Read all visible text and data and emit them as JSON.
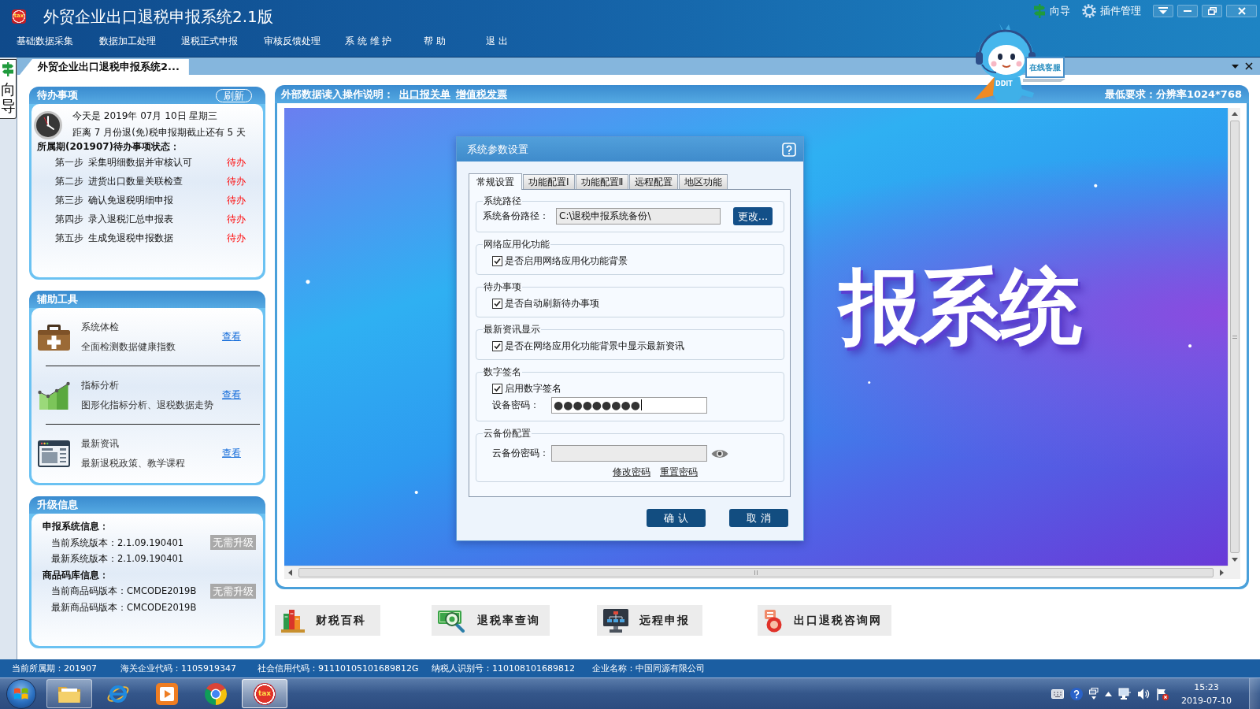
{
  "window": {
    "title": "外贸企业出口退税申报系统2.1版",
    "icon_text": "tax",
    "top_links": [
      {
        "kind": "guide",
        "label": "向导"
      },
      {
        "kind": "plugins",
        "label": "插件管理"
      }
    ]
  },
  "menu": [
    "基础数据采集",
    "数据加工处理",
    "退税正式申报",
    "审核反馈处理",
    "系 统 维 护",
    "帮 助",
    "退 出"
  ],
  "doc_tabs": [
    {
      "label": "外贸企业出口退税申报系统2...",
      "selected": true
    }
  ],
  "guide_tab": {
    "label": "向导"
  },
  "mascot": {
    "sign": "在线客服",
    "chest_text": "DDIT"
  },
  "todo_panel": {
    "title": "待办事项",
    "refresh": "刷新",
    "date_line": "今天是 2019年 07月 10日 星期三",
    "deadline_line": "距离 7 月份退(免)税申报期截止还有 5 天",
    "status_heading": "所属期(201907)待办事项状态：",
    "steps": [
      {
        "step": "第一步",
        "task": "采集明细数据并审核认可",
        "status": "待办"
      },
      {
        "step": "第二步",
        "task": "进货出口数量关联检查",
        "status": "待办"
      },
      {
        "step": "第三步",
        "task": "确认免退税明细申报",
        "status": "待办"
      },
      {
        "step": "第四步",
        "task": "录入退税汇总申报表",
        "status": "待办"
      },
      {
        "step": "第五步",
        "task": "生成免退税申报数据",
        "status": "待办"
      }
    ]
  },
  "tools_panel": {
    "title": "辅助工具",
    "items": [
      {
        "kind": "checkup",
        "title": "系统体检",
        "description": "全面检测数据健康指数",
        "link": "查看"
      },
      {
        "kind": "analysis",
        "title": "指标分析",
        "description": "图形化指标分析、退税数据走势",
        "link": "查看"
      },
      {
        "kind": "news",
        "title": "最新资讯",
        "description": "最新退税政策、教学课程",
        "link": "查看"
      }
    ]
  },
  "upgrade_panel": {
    "title": "升级信息",
    "groups": [
      {
        "heading": "申报系统信息：",
        "current": "当前系统版本：2.1.09.190401",
        "latest": "最新系统版本：2.1.09.190401",
        "badge": "无需升级",
        "disabled": true
      },
      {
        "heading": "商品码库信息：",
        "current": "当前商品码版本：CMCODE2019B",
        "latest": "最新商品码版本：CMCODE2019B",
        "badge": "无需升级",
        "disabled": true
      }
    ]
  },
  "content_panel": {
    "header_label": "外部数据读入操作说明：",
    "header_links": [
      "出口报关单",
      "增值税发票"
    ],
    "requirement": "最低要求：分辨率1024*768",
    "banner_text": "报系统"
  },
  "dialog": {
    "title": "系统参数设置",
    "tabs": [
      {
        "label": "常规设置",
        "selected": true
      },
      {
        "label": "功能配置Ⅰ",
        "selected": false
      },
      {
        "label": "功能配置Ⅱ",
        "selected": false
      },
      {
        "label": "远程配置",
        "selected": false
      },
      {
        "label": "地区功能",
        "selected": false
      }
    ],
    "groups": [
      {
        "kind": "path",
        "legend": "系统路径",
        "field_label": "系统备份路径：",
        "value": "C:\\退税申报系统备份\\",
        "readonly": true,
        "button": "更改..."
      },
      {
        "kind": "option",
        "legend": "网络应用化功能",
        "option": {
          "label": "是否启用网络应用化功能背景",
          "checked": true
        }
      },
      {
        "kind": "option",
        "legend": "待办事项",
        "option": {
          "label": "是否自动刷新待办事项",
          "checked": true
        }
      },
      {
        "kind": "option",
        "legend": "最新资讯显示",
        "option": {
          "label": "是否在网络应用化功能背景中显示最新资讯",
          "checked": true
        }
      },
      {
        "kind": "signature",
        "legend": "数字签名",
        "option": {
          "label": "启用数字签名",
          "checked": true
        },
        "field_label": "设备密码：",
        "value": "●●●●●●●●●",
        "focused": true
      },
      {
        "kind": "cloud",
        "legend": "云备份配置",
        "field_label": "云备份密码：",
        "disabled": true,
        "links": [
          "修改密码",
          "重置密码"
        ]
      }
    ],
    "buttons": [
      "确 认",
      "取 消"
    ]
  },
  "shortcuts": [
    {
      "kind": "encyclopedia",
      "label": "财税百科"
    },
    {
      "kind": "rate",
      "label": "退税率查询"
    },
    {
      "kind": "remote",
      "label": "远程申报"
    },
    {
      "kind": "website",
      "label": "出口退税咨询网"
    }
  ],
  "status_bar": [
    "当前所属期：201907",
    "海关企业代码：1105919347",
    "社会信用代码：91110105101689812G",
    "纳税人识别号：110108101689812",
    "企业名称：中国同源有限公司"
  ],
  "taskbar": {
    "apps": [
      {
        "kind": "folder",
        "running": true,
        "selected": false
      },
      {
        "kind": "e-browser",
        "running": false,
        "selected": false
      },
      {
        "kind": "player",
        "running": false,
        "selected": false
      },
      {
        "kind": "round-browser",
        "running": false,
        "selected": false
      },
      {
        "kind": "tax-app",
        "running": true,
        "selected": true,
        "icon_text": "tax"
      }
    ],
    "time": "15:23",
    "date": "2019-07-10"
  }
}
